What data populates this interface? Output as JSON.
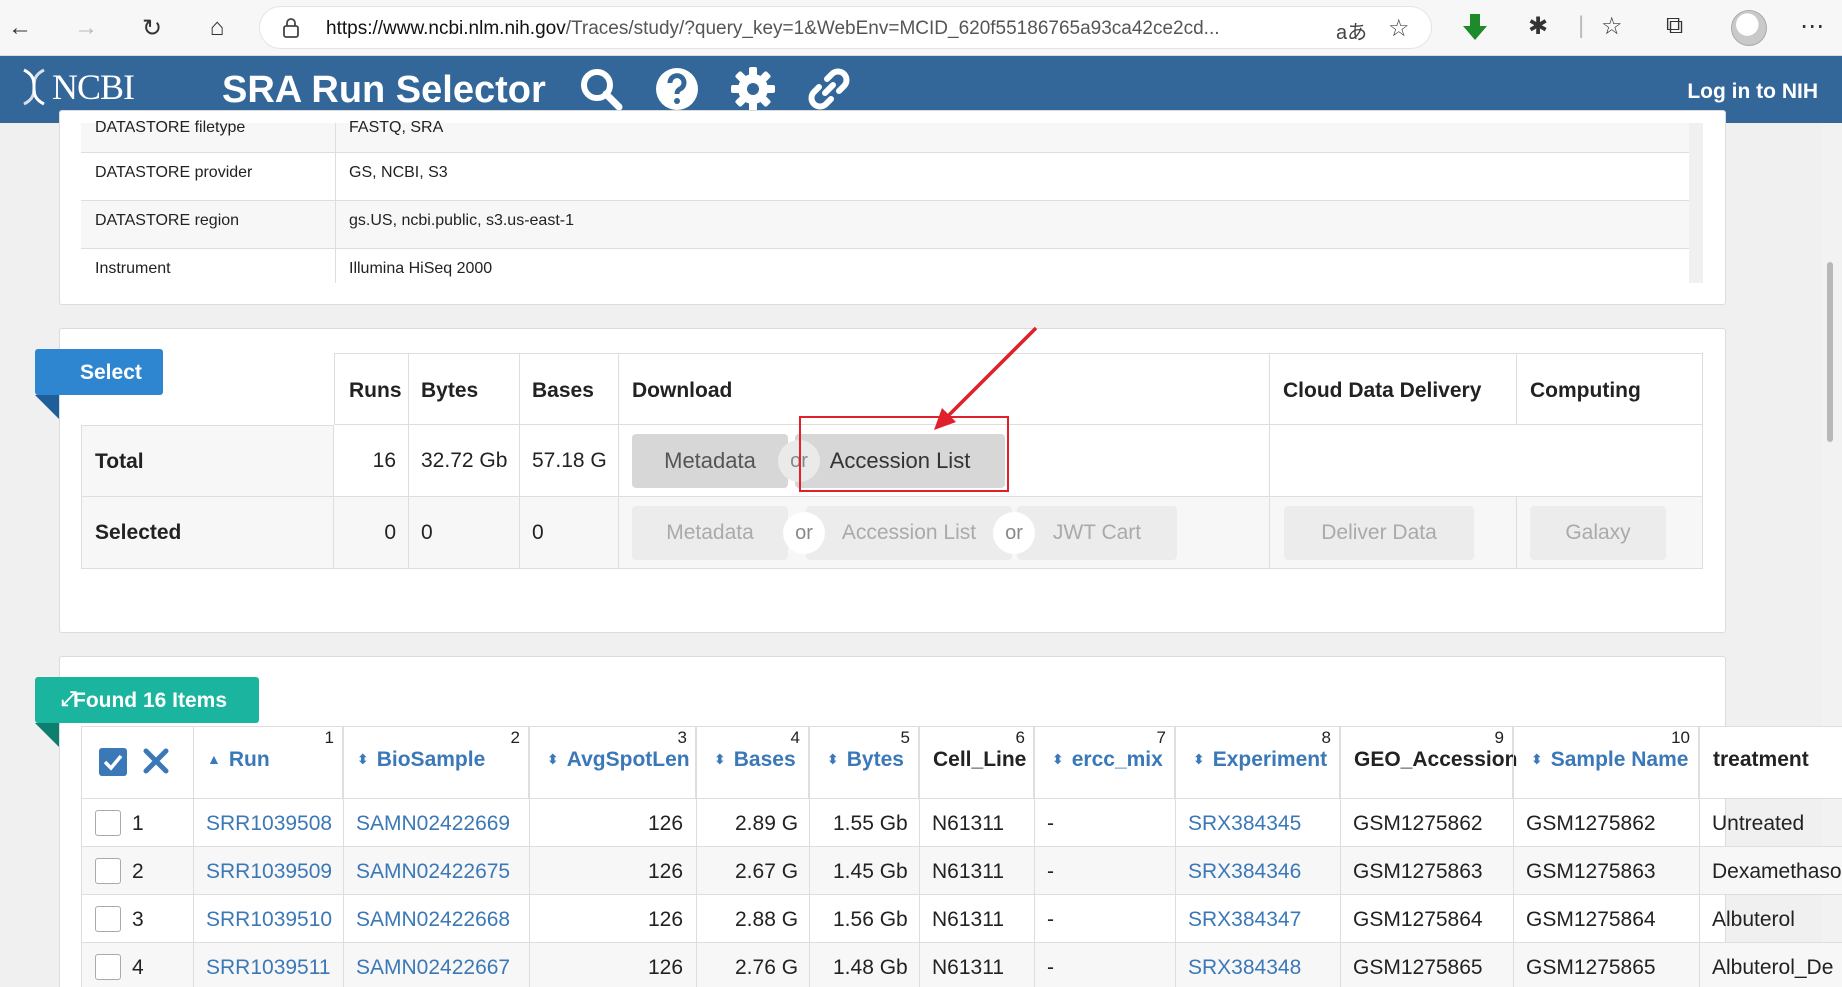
{
  "browser": {
    "url_host": "https://www.ncbi.nlm.nih.gov",
    "url_path": "/Traces/study/?query_key=1&WebEnv=MCID_620f55186765a93ca42ce2cd...",
    "read_aloud": "aあ"
  },
  "header": {
    "logo": "NCBI",
    "title": "SRA Run Selector",
    "login": "Log in to NIH",
    "color": "#336699"
  },
  "metadata": {
    "rows": [
      {
        "key": "DATASTORE filetype",
        "value": "FASTQ, SRA"
      },
      {
        "key": "DATASTORE provider",
        "value": "GS, NCBI, S3"
      },
      {
        "key": "DATASTORE region",
        "value": "gs.US, ncbi.public, s3.us-east-1"
      },
      {
        "key": "Instrument",
        "value": "Illumina HiSeq 2000"
      }
    ]
  },
  "select": {
    "ribbon": "Select",
    "ribbon_color": "#2f86d0",
    "headers": {
      "runs": "Runs",
      "bytes": "Bytes",
      "bases": "Bases",
      "download": "Download",
      "cloud": "Cloud Data Delivery",
      "computing": "Computing"
    },
    "total": {
      "label": "Total",
      "runs": "16",
      "bytes": "32.72 Gb",
      "bases": "57.18 G"
    },
    "selected": {
      "label": "Selected",
      "runs": "0",
      "bytes": "0",
      "bases": "0"
    },
    "buttons": {
      "metadata": "Metadata",
      "or": "or",
      "accession_list": "Accession List",
      "jwt_cart": "JWT Cart",
      "deliver_data": "Deliver Data",
      "galaxy": "Galaxy"
    }
  },
  "found": {
    "ribbon": "Found 16 Items",
    "ribbon_color": "#1bb59f",
    "columns": [
      {
        "label": "Run",
        "num": "1"
      },
      {
        "label": "BioSample",
        "num": "2"
      },
      {
        "label": "AvgSpotLen",
        "num": "3"
      },
      {
        "label": "Bases",
        "num": "4"
      },
      {
        "label": "Bytes",
        "num": "5"
      },
      {
        "label": "Cell_Line",
        "num": "6"
      },
      {
        "label": "ercc_mix",
        "num": "7"
      },
      {
        "label": "Experiment",
        "num": "8"
      },
      {
        "label": "GEO_Accession",
        "num": "9"
      },
      {
        "label": "Sample Name",
        "num": "10"
      },
      {
        "label": "treatment",
        "num": ""
      }
    ],
    "rows": [
      {
        "idx": "1",
        "run": "SRR1039508",
        "biosample": "SAMN02422669",
        "avgspotlen": "126",
        "bases": "2.89 G",
        "bytes": "1.55 Gb",
        "cell_line": "N61311",
        "ercc": "-",
        "experiment": "SRX384345",
        "geo": "GSM1275862",
        "sample": "GSM1275862",
        "treatment": "Untreated"
      },
      {
        "idx": "2",
        "run": "SRR1039509",
        "biosample": "SAMN02422675",
        "avgspotlen": "126",
        "bases": "2.67 G",
        "bytes": "1.45 Gb",
        "cell_line": "N61311",
        "ercc": "-",
        "experiment": "SRX384346",
        "geo": "GSM1275863",
        "sample": "GSM1275863",
        "treatment": "Dexamethaso"
      },
      {
        "idx": "3",
        "run": "SRR1039510",
        "biosample": "SAMN02422668",
        "avgspotlen": "126",
        "bases": "2.88 G",
        "bytes": "1.56 Gb",
        "cell_line": "N61311",
        "ercc": "-",
        "experiment": "SRX384347",
        "geo": "GSM1275864",
        "sample": "GSM1275864",
        "treatment": "Albuterol"
      },
      {
        "idx": "4",
        "run": "SRR1039511",
        "biosample": "SAMN02422667",
        "avgspotlen": "126",
        "bases": "2.76 G",
        "bytes": "1.48 Gb",
        "cell_line": "N61311",
        "ercc": "-",
        "experiment": "SRX384348",
        "geo": "GSM1275865",
        "sample": "GSM1275865",
        "treatment": "Albuterol_De"
      }
    ]
  }
}
